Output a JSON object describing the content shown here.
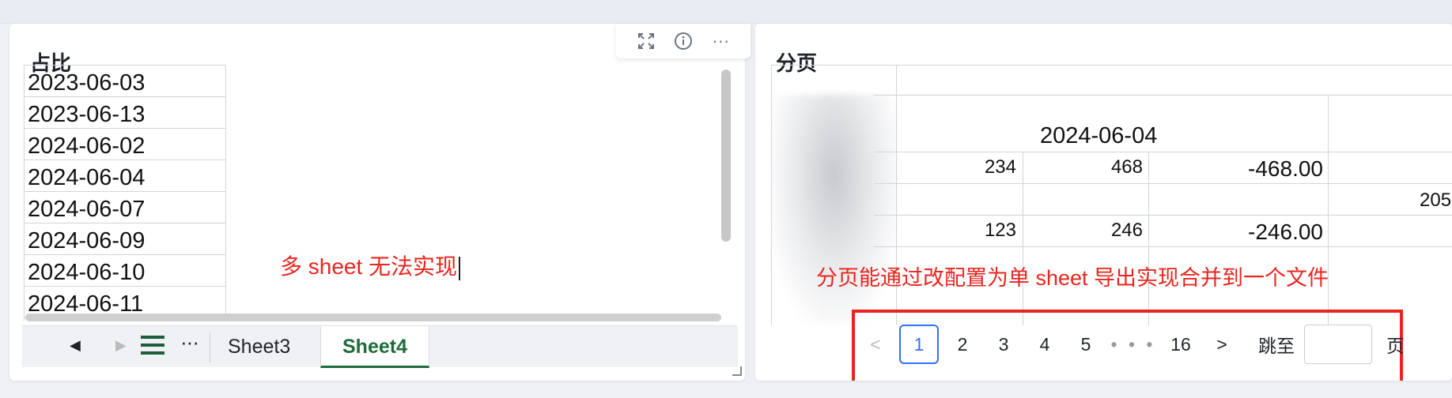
{
  "left_card": {
    "title": "占比",
    "toolbar": {
      "expand_icon": "expand-icon",
      "info_icon": "info-icon",
      "more_icon": "more-icon",
      "more_glyph": "···"
    },
    "dates": [
      "2023-06-03",
      "2023-06-13",
      "2024-06-02",
      "2024-06-04",
      "2024-06-07",
      "2024-06-09",
      "2024-06-10",
      "2024-06-11"
    ],
    "annotation": "多 sheet 无法实现",
    "tabs": [
      "Sheet3",
      "Sheet4"
    ],
    "active_tab": "Sheet4",
    "more_glyph": "···"
  },
  "right_card": {
    "title": "分页",
    "table": {
      "header_date": "2024-06-04",
      "rows": [
        [
          "234",
          "468",
          "-468.00"
        ],
        [
          "123",
          "246",
          "-246.00"
        ]
      ],
      "partial_value": "205"
    },
    "annotation": "分页能通过改配置为单 sheet 导出实现合并到一个文件",
    "pagination": {
      "prev": "<",
      "pages": [
        "1",
        "2",
        "3",
        "4",
        "5"
      ],
      "ellipsis": "• • •",
      "last": "16",
      "next": ">",
      "jump_label": "跳至",
      "jump_value": "",
      "jump_unit": "页"
    }
  },
  "colors": {
    "annotation_red": "#e8261f",
    "sheet_active_green": "#1f6b3a",
    "page_active_blue": "#3370ff"
  }
}
